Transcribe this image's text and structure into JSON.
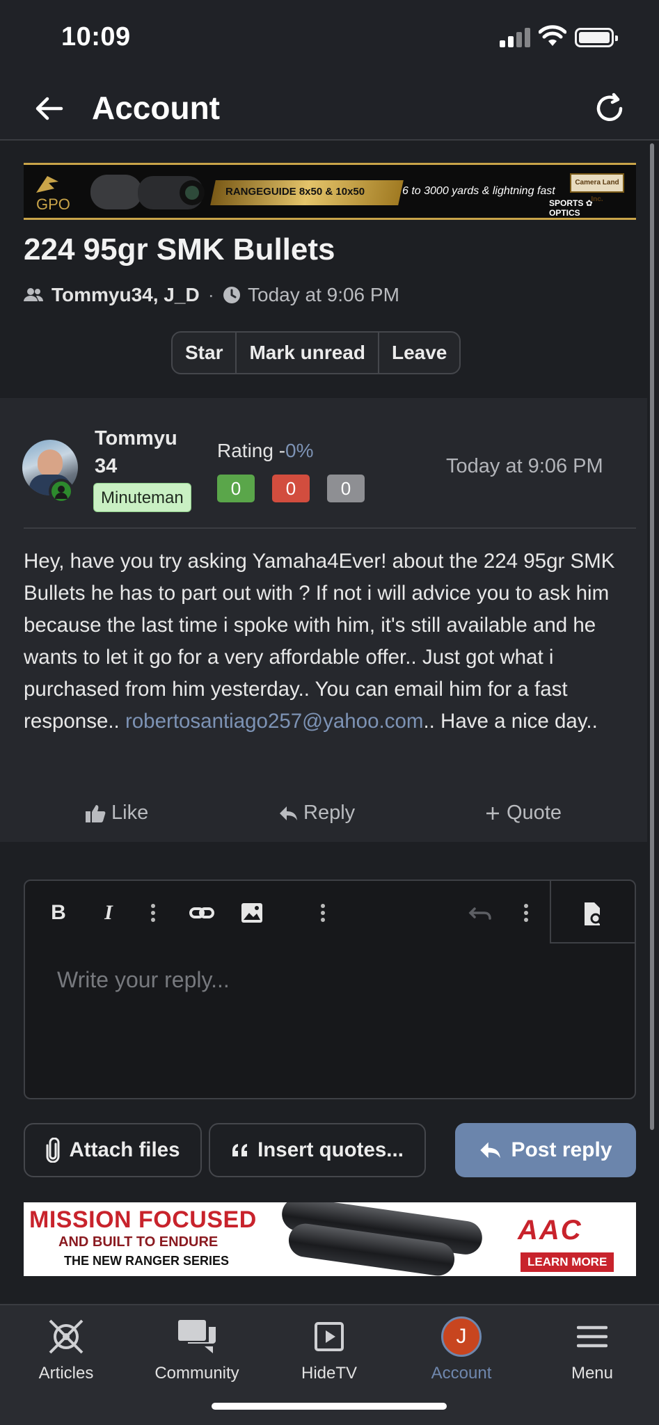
{
  "status_bar": {
    "time": "10:09"
  },
  "header": {
    "title": "Account"
  },
  "top_banner": {
    "brand": "GPO",
    "product": "RANGEGUIDE 8x50 & 10x50",
    "tagline": "6 to 3000 yards & lightning fast",
    "partner": "Camera Land Inc.",
    "partner_tag": "SPORTS ✿ OPTICS"
  },
  "thread": {
    "title": "224 95gr SMK Bullets",
    "participants": "Tommyu34, J_D",
    "separator": "·",
    "time": "Today at 9:06 PM",
    "actions": [
      "Star",
      "Mark unread",
      "Leave"
    ]
  },
  "post": {
    "username": "Tommyu 34",
    "user_badge": "Minuteman",
    "rating_label": "Rating -",
    "rating_pct": "0%",
    "ratings": [
      {
        "value": "0",
        "color": "#5aa64a"
      },
      {
        "value": "0",
        "color": "#d24d3e"
      },
      {
        "value": "0",
        "color": "#8e8f93"
      }
    ],
    "time": "Today at 9:06 PM",
    "body_text": "Hey, have you try asking Yamaha4Ever! about the 224 95gr SMK Bullets he has to part out with ? If not i will advice you to ask him because the last time i spoke with him, it's still available and he wants to let it go for a very affordable offer.. Just got what i purchased from him yesterday.. You can email him for a fast response.. ",
    "email": "robertosantiago257@yahoo.com",
    "body_end": ".. Have a nice day..",
    "like": "Like",
    "reply": "Reply",
    "quote": "Quote"
  },
  "editor": {
    "placeholder": "Write your reply...",
    "bold": "B",
    "italic": "I"
  },
  "footer_buttons": {
    "attach": "Attach files",
    "insert_quotes": "Insert quotes...",
    "post_reply": "Post reply"
  },
  "bottom_banner": {
    "line1": "MISSION FOCUSED",
    "line2": "AND BUILT TO ENDURE",
    "line3": "THE NEW RANGER SERIES",
    "brand": "AAC",
    "cta": "LEARN MORE"
  },
  "tabbar": {
    "tabs": [
      {
        "label": "Articles",
        "icon": "articles-icon"
      },
      {
        "label": "Community",
        "icon": "community-icon"
      },
      {
        "label": "HideTV",
        "icon": "play-icon"
      },
      {
        "label": "Account",
        "icon": "account-avatar",
        "initial": "J",
        "active": true
      },
      {
        "label": "Menu",
        "icon": "menu-icon"
      }
    ]
  },
  "colors": {
    "accent": "#6b85ac",
    "link": "#7d93b5",
    "background": "#1d1f23"
  }
}
